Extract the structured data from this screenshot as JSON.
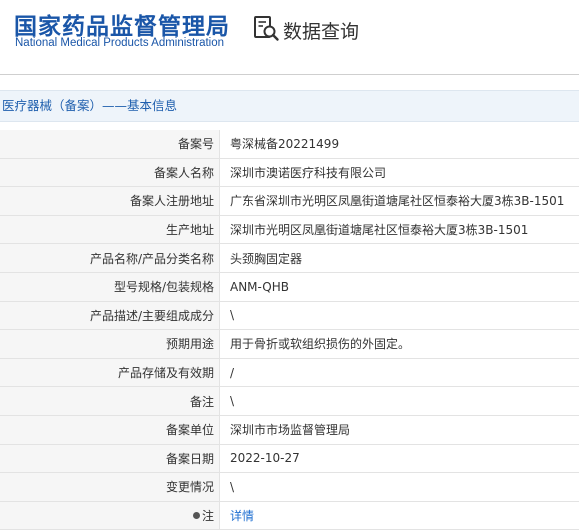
{
  "header": {
    "logo_cn": "国家药品监督管理局",
    "logo_en": "National Medical Products Administration",
    "query_icon": "search-document-icon",
    "query_label": "数据查询"
  },
  "section": {
    "title": "医疗器械（备案）——基本信息"
  },
  "record": [
    {
      "label": "备案号",
      "value": "粤深械备20221499"
    },
    {
      "label": "备案人名称",
      "value": "深圳市澳诺医疗科技有限公司"
    },
    {
      "label": "备案人注册地址",
      "value": "广东省深圳市光明区凤凰街道塘尾社区恒泰裕大厦3栋3B-1501"
    },
    {
      "label": "生产地址",
      "value": "深圳市光明区凤凰街道塘尾社区恒泰裕大厦3栋3B-1501"
    },
    {
      "label": "产品名称/产品分类名称",
      "value": "头颈胸固定器"
    },
    {
      "label": "型号规格/包装规格",
      "value": "ANM-QHB"
    },
    {
      "label": "产品描述/主要组成成分",
      "value": "\\"
    },
    {
      "label": "预期用途",
      "value": "用于骨折或软组织损伤的外固定。"
    },
    {
      "label": "产品存储及有效期",
      "value": "/"
    },
    {
      "label": "备注",
      "value": "\\"
    },
    {
      "label": "备案单位",
      "value": "深圳市市场监督管理局"
    },
    {
      "label": "备案日期",
      "value": "2022-10-27"
    },
    {
      "label": "变更情况",
      "value": "\\"
    }
  ],
  "note": {
    "label": "注",
    "link": "详情"
  }
}
